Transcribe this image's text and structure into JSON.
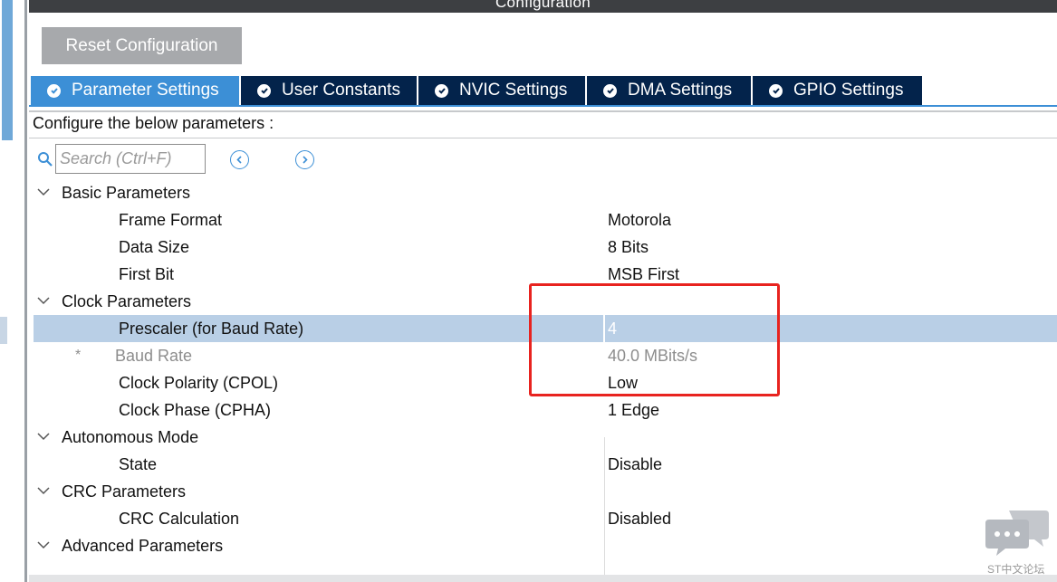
{
  "window": {
    "title": "Configuration"
  },
  "toolbar": {
    "reset_label": "Reset Configuration"
  },
  "tabs": [
    {
      "label": "Parameter Settings",
      "active": true
    },
    {
      "label": "User Constants",
      "active": false
    },
    {
      "label": "NVIC Settings",
      "active": false
    },
    {
      "label": "DMA Settings",
      "active": false
    },
    {
      "label": "GPIO Settings",
      "active": false
    }
  ],
  "panel": {
    "instruction": "Configure the below parameters :"
  },
  "search": {
    "placeholder": "Search (Ctrl+F)",
    "value": ""
  },
  "groups": {
    "basic": "Basic Parameters",
    "clock": "Clock Parameters",
    "autonomous": "Autonomous Mode",
    "crc": "CRC Parameters",
    "advanced": "Advanced Parameters"
  },
  "params": {
    "frame_format": {
      "label": "Frame Format",
      "value": "Motorola"
    },
    "data_size": {
      "label": "Data Size",
      "value": "8 Bits"
    },
    "first_bit": {
      "label": "First Bit",
      "value": "MSB First"
    },
    "prescaler": {
      "label": "Prescaler (for Baud Rate)",
      "value": "4"
    },
    "baud_rate": {
      "marker": "*",
      "label": "Baud Rate",
      "value": "40.0 MBits/s"
    },
    "cpol": {
      "label": "Clock Polarity (CPOL)",
      "value": "Low"
    },
    "cpha": {
      "label": "Clock Phase (CPHA)",
      "value": "1 Edge"
    },
    "state": {
      "label": "State",
      "value": "Disable"
    },
    "crc_calc": {
      "label": "CRC Calculation",
      "value": "Disabled"
    }
  },
  "watermark": {
    "text": "ST中文论坛"
  },
  "colors": {
    "accent_blue": "#3c8fd6",
    "tab_dark": "#03234b",
    "selection": "#b9cfe6",
    "annotation_red": "#e8231f"
  }
}
